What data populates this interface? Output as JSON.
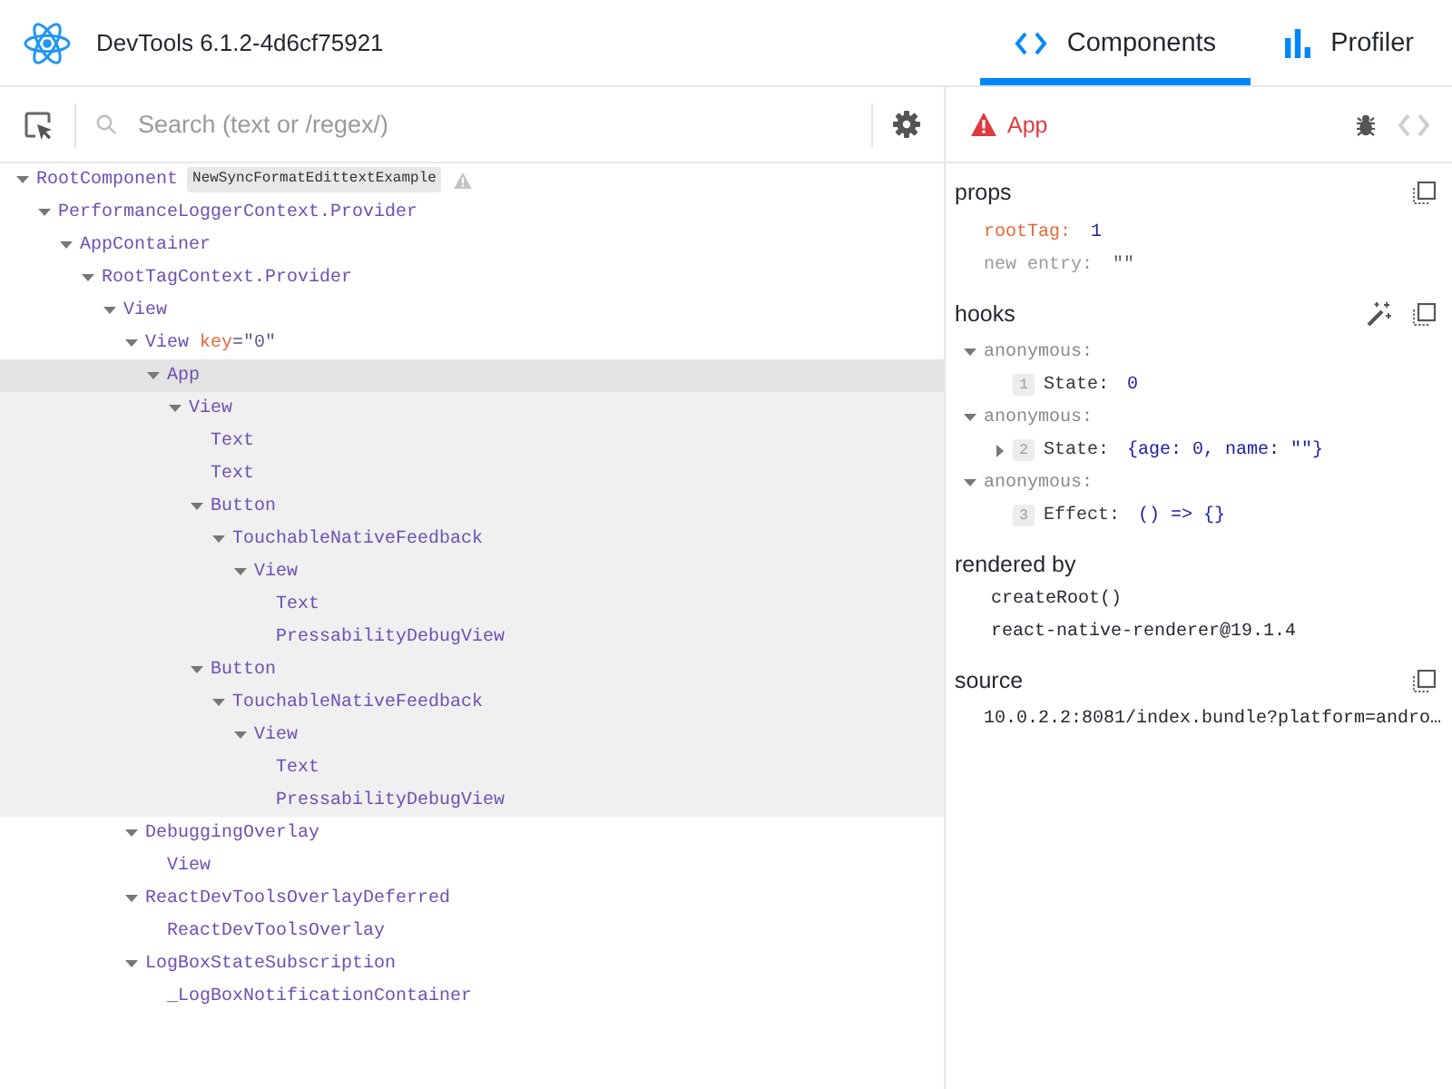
{
  "toolbar": {
    "title": "DevTools 6.1.2-4d6cf75921",
    "tabs": [
      {
        "kind": "components",
        "label": "Components",
        "selected": true
      },
      {
        "kind": "profiler",
        "label": "Profiler",
        "selected": false
      }
    ]
  },
  "search": {
    "placeholder": "Search (text or /regex/)"
  },
  "tree": [
    {
      "name": "RootComponent",
      "badges": [
        "NewSyncFormatEdittextExample"
      ],
      "expanded": true,
      "selected": false,
      "children": [
        {
          "name": "PerformanceLoggerContext.Provider",
          "expanded": true,
          "selected": false,
          "children": [
            {
              "name": "AppContainer",
              "expanded": true,
              "selected": false,
              "children": [
                {
                  "name": "RootTagContext.Provider",
                  "expanded": true,
                  "selected": false,
                  "children": [
                    {
                      "name": "View",
                      "expanded": true,
                      "selected": false,
                      "children": [
                        {
                          "name": "View",
                          "key": {
                            "label": "key",
                            "value": "=\"0\""
                          },
                          "expanded": true,
                          "selected": false,
                          "children": [
                            {
                              "name": "App",
                              "expanded": true,
                              "selected": true,
                              "children": [
                                {
                                  "name": "View",
                                  "expanded": true,
                                  "selected": false,
                                  "children": [
                                    {
                                      "name": "Text",
                                      "selected": false
                                    },
                                    {
                                      "name": "Text",
                                      "selected": false
                                    },
                                    {
                                      "name": "Button",
                                      "expanded": true,
                                      "selected": false,
                                      "children": [
                                        {
                                          "name": "TouchableNativeFeedback",
                                          "expanded": true,
                                          "selected": false,
                                          "children": [
                                            {
                                              "name": "View",
                                              "expanded": true,
                                              "selected": false,
                                              "children": [
                                                {
                                                  "name": "Text",
                                                  "selected": false
                                                },
                                                {
                                                  "name": "PressabilityDebugView",
                                                  "selected": false
                                                }
                                              ]
                                            }
                                          ]
                                        }
                                      ]
                                    },
                                    {
                                      "name": "Button",
                                      "expanded": true,
                                      "selected": false,
                                      "children": [
                                        {
                                          "name": "TouchableNativeFeedback",
                                          "expanded": true,
                                          "selected": false,
                                          "children": [
                                            {
                                              "name": "View",
                                              "expanded": true,
                                              "selected": false,
                                              "children": [
                                                {
                                                  "name": "Text",
                                                  "selected": false
                                                },
                                                {
                                                  "name": "PressabilityDebugView",
                                                  "selected": false
                                                }
                                              ]
                                            }
                                          ]
                                        }
                                      ]
                                    }
                                  ]
                                }
                              ]
                            }
                          ]
                        },
                        {
                          "name": "DebuggingOverlay",
                          "expanded": true,
                          "selected": false,
                          "children": [
                            {
                              "name": "View",
                              "selected": false
                            }
                          ]
                        },
                        {
                          "name": "ReactDevToolsOverlayDeferred",
                          "expanded": true,
                          "selected": false,
                          "children": [
                            {
                              "name": "ReactDevToolsOverlay",
                              "selected": false
                            }
                          ]
                        },
                        {
                          "name": "LogBoxStateSubscription",
                          "expanded": true,
                          "selected": false,
                          "children": [
                            {
                              "name": "_LogBoxNotificationContainer",
                              "selected": false
                            }
                          ]
                        }
                      ]
                    }
                  ]
                }
              ]
            }
          ]
        }
      ]
    }
  ],
  "inspector": {
    "component": "App",
    "props": {
      "title": "props",
      "items": [
        {
          "kind": "prop",
          "name": "rootTag:",
          "value": "1"
        },
        {
          "kind": "new",
          "name": "new entry:",
          "value": "\"\""
        }
      ]
    },
    "hooks": {
      "title": "hooks",
      "items": [
        {
          "name": "anonymous:",
          "expanded": true,
          "children": [
            {
              "index": "1",
              "name": "State:",
              "value": "0"
            }
          ]
        },
        {
          "name": "anonymous:",
          "expanded": true,
          "children": [
            {
              "index": "2",
              "name": "State:",
              "value": "{age: 0, name: \"\"}",
              "expanded": false
            }
          ]
        },
        {
          "name": "anonymous:",
          "expanded": true,
          "children": [
            {
              "index": "3",
              "name": "Effect:",
              "value": "() => {}"
            }
          ]
        }
      ]
    },
    "rendered_by": {
      "title": "rendered by",
      "items": [
        "createRoot()",
        "react-native-renderer@19.1.4"
      ]
    },
    "source": {
      "title": "source",
      "location": "10.0.2.2:8081/index.bundle?platform=andro…"
    }
  }
}
